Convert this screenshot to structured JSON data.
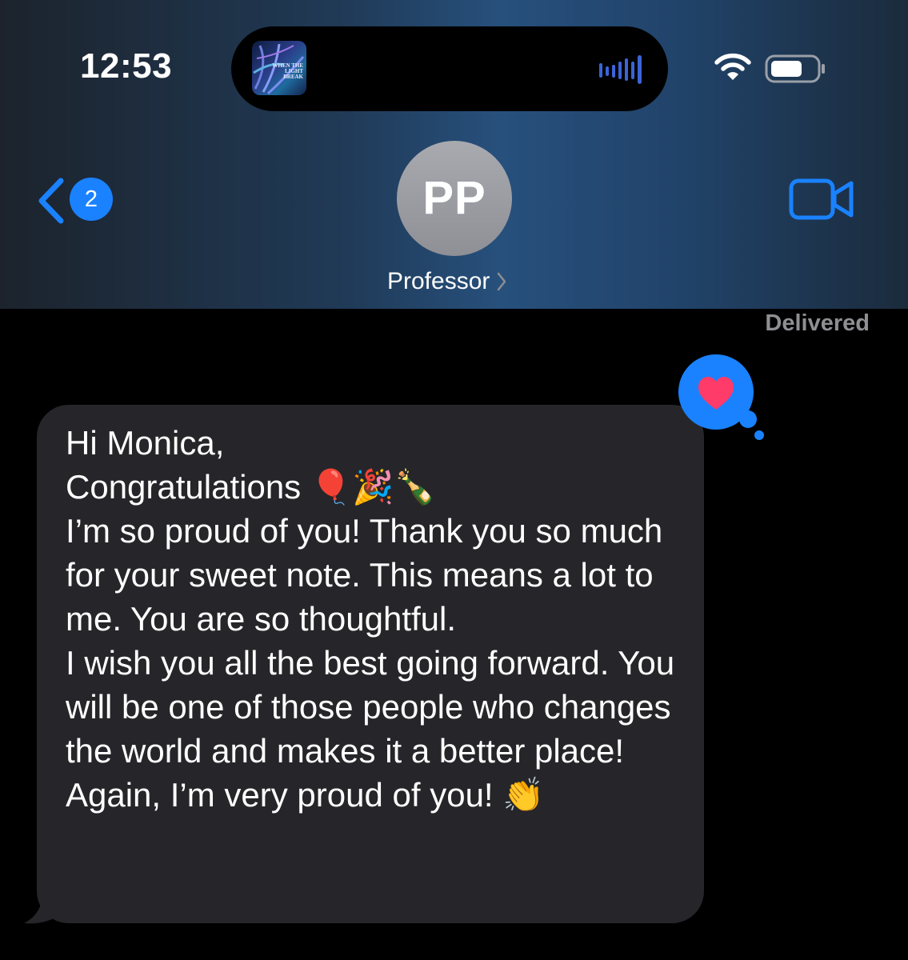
{
  "status_bar": {
    "time": "12:53",
    "now_playing": {
      "album_art_text": "WHEN THE LIGHT BREAK",
      "waveform_icon": "audio-waveform-icon"
    },
    "wifi_icon": "wifi-icon",
    "battery_icon": "battery-icon"
  },
  "nav": {
    "back_icon": "chevron-left-icon",
    "unread_count": "2",
    "contact_initials": "PP",
    "contact_name": "Professor",
    "video_icon": "video-camera-icon"
  },
  "conversation": {
    "delivered_label": "Delivered",
    "messages": [
      {
        "direction": "incoming",
        "text": "Hi Monica,\nCongratulations 🎈🎉🍾\nI’m so proud of you! Thank you so much for your sweet note. This means a lot to me. You are so thoughtful.\nI wish you all the best going forward. You will be one of those people who changes the world and makes it a better place!\nAgain, I’m very proud of you! 👏",
        "tapback": "heart"
      }
    ]
  },
  "colors": {
    "accent": "#1a82ff",
    "bubble_incoming": "#26262a",
    "tapback_heart": "#ff3b6a",
    "background": "#000000"
  }
}
